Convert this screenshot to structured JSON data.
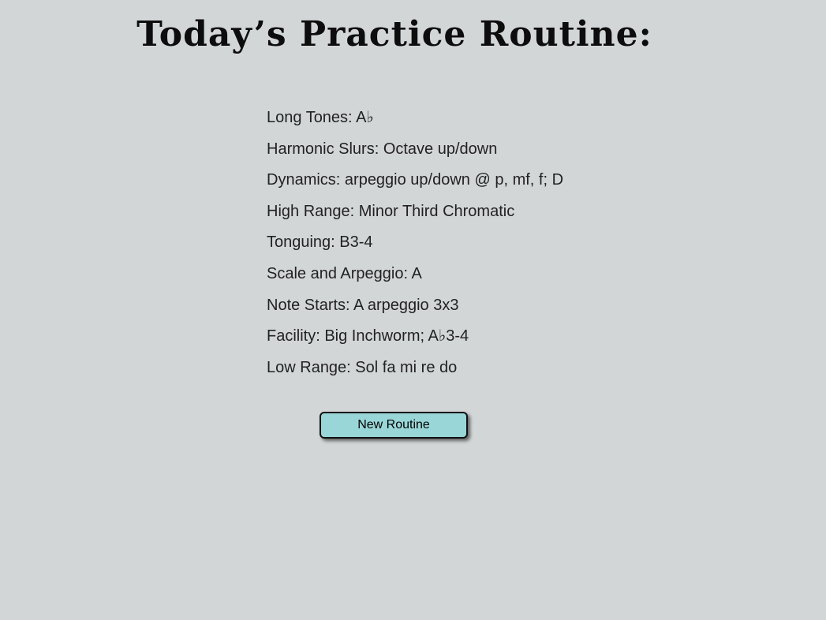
{
  "page": {
    "title": "Today’s Practice Routine:"
  },
  "routine": {
    "items": [
      "Long Tones: A♭",
      "Harmonic Slurs: Octave up/down",
      "Dynamics: arpeggio up/down @ p, mf, f; D",
      "High Range: Minor Third Chromatic",
      "Tonguing: B3-4",
      "Scale and Arpeggio: A",
      "Note Starts: A arpeggio 3x3",
      "Facility: Big Inchworm; A♭3-4",
      "Low Range: Sol fa mi re do"
    ]
  },
  "actions": {
    "new_routine_label": "New Routine"
  },
  "colors": {
    "background": "#d3d6d7",
    "button_fill": "#99d6d8"
  }
}
